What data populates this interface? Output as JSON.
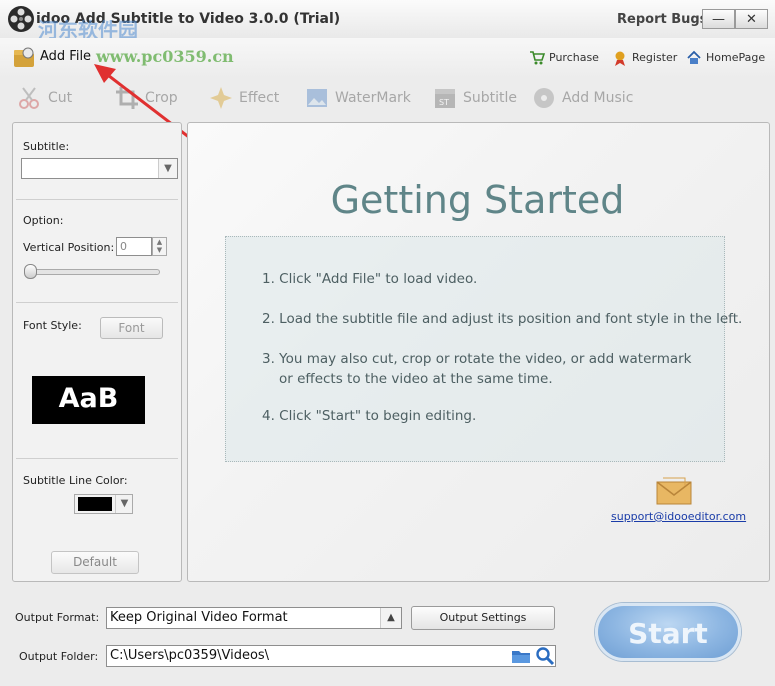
{
  "window": {
    "title": "idoo Add Subtitle to Video 3.0.0 (Trial)",
    "report_bugs": "Report Bugs",
    "minimize": "—",
    "close": "✕",
    "watermark_cn": "河东软件园",
    "watermark_url": "www.pc0359.cn"
  },
  "toolbar": {
    "add_file": "Add File",
    "purchase": "Purchase",
    "register": "Register",
    "homepage": "HomePage"
  },
  "tools": [
    {
      "label": "Cut",
      "icon": "scissors-icon"
    },
    {
      "label": "Crop",
      "icon": "crop-icon"
    },
    {
      "label": "Effect",
      "icon": "sparkle-icon"
    },
    {
      "label": "WaterMark",
      "icon": "picture-icon"
    },
    {
      "label": "Subtitle",
      "icon": "clapperboard-icon"
    },
    {
      "label": "Add Music",
      "icon": "disc-icon"
    }
  ],
  "left_panel": {
    "subtitle_label": "Subtitle:",
    "subtitle_value": "",
    "option_label": "Option:",
    "vertical_position_label": "Vertical Position:",
    "vertical_position_value": "0",
    "slider_value": 0,
    "font_style_label": "Font Style:",
    "font_button": "Font",
    "font_preview": "AaB",
    "line_color_label": "Subtitle Line Color:",
    "line_color": "#000000",
    "default_button": "Default"
  },
  "getting_started": {
    "title": "Getting Started",
    "steps": [
      "1. Click \"Add File\" to load video.",
      "2. Load the subtitle file and adjust its position and font style in the left.",
      "3. You may also cut, crop or rotate the video, or add watermark",
      "or effects to the video at the same time.",
      "4. Click \"Start\" to begin editing."
    ],
    "support_email": "support@idooeditor.com"
  },
  "output": {
    "format_label": "Output Format:",
    "format_value": "Keep Original Video Format",
    "settings_button": "Output Settings",
    "folder_label": "Output Folder:",
    "folder_value": "C:\\Users\\pc0359\\Videos\\",
    "start_button": "Start"
  },
  "colors": {
    "accent_arrow": "#e03030",
    "start_blue": "#8db6e2",
    "title_teal": "#5f8588"
  }
}
